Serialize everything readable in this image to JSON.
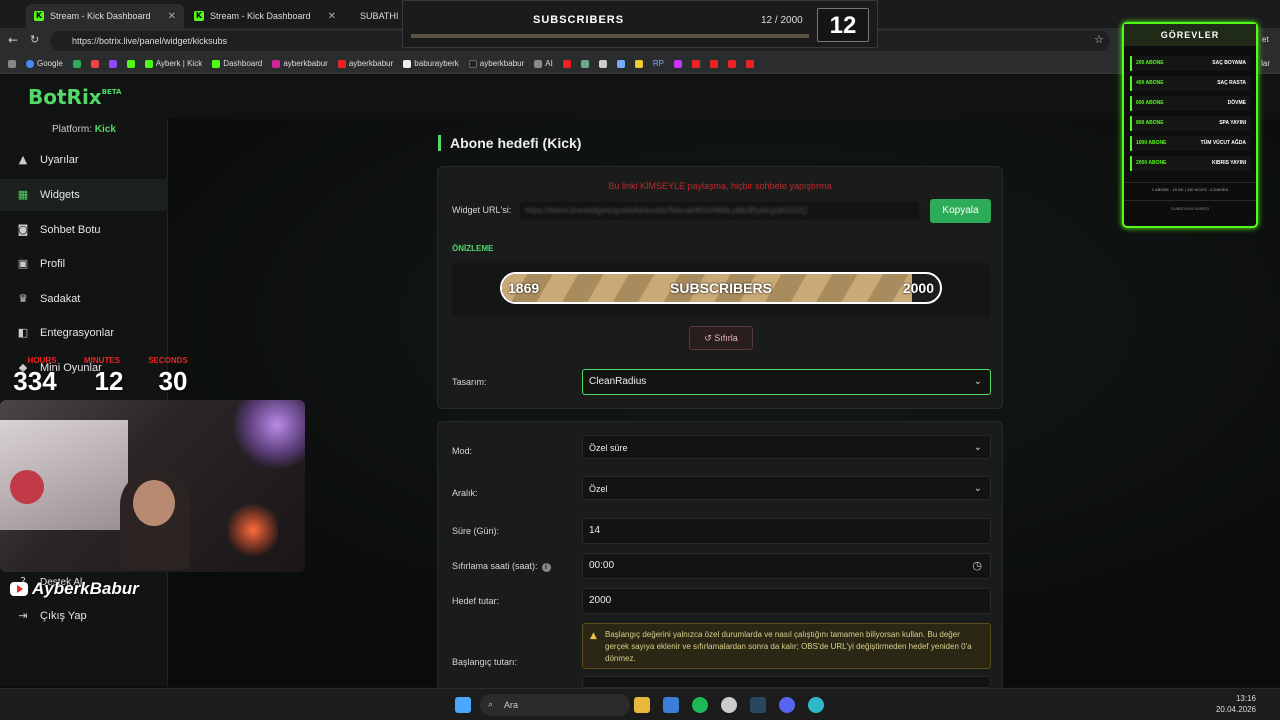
{
  "browser": {
    "tabs": [
      {
        "label": "Stream - Kick Dashboard"
      },
      {
        "label": "Stream - Kick Dashboard"
      },
      {
        "label": "SUBATHI"
      }
    ],
    "url": "https://botrix.live/panel/widget/kicksubs",
    "right_partial": "et",
    "bookmarks": [
      "Google",
      "Ayberk | Kick",
      "Dashboard",
      "ayberkbabur",
      "ayberkbabur",
      "baburayberk",
      "ayberkbabur",
      "AI",
      "RP",
      "lar"
    ]
  },
  "app": {
    "logo": "BotRix",
    "logo_badge": "BETA",
    "platform_label": "Platform:",
    "platform_value": "Kick"
  },
  "sidebar": {
    "items": [
      {
        "label": "Uyarılar",
        "icon": "warning-icon"
      },
      {
        "label": "Widgets",
        "icon": "grid-icon"
      },
      {
        "label": "Sohbet Botu",
        "icon": "robot-icon"
      },
      {
        "label": "Profil",
        "icon": "profile-icon"
      },
      {
        "label": "Sadakat",
        "icon": "trophy-icon"
      },
      {
        "label": "Entegrasyonlar",
        "icon": "integration-icon"
      },
      {
        "label": "Mini Oyunlar",
        "icon": "game-icon"
      },
      {
        "label": "Destek Al",
        "icon": "support-icon"
      },
      {
        "label": "Çıkış Yap",
        "icon": "logout-icon"
      }
    ]
  },
  "main": {
    "title": "Abone hedefi (Kick)",
    "warning": "Bu linki KİMSEYLE paylaşma, hiçbir sohbete yapıştırma",
    "url_label": "Widget URL'si:",
    "url_value": "https://botrix.live/widgets/goals/kicksubs?bid=aHR0cHM6Ly9ib3RyaXgubGl2ZQ",
    "copy_label": "Kopyala",
    "preview_label": "ÖNİZLEME",
    "preview": {
      "start": "1869",
      "title": "SUBSCRIBERS",
      "goal": "2000",
      "progress": 0.935
    },
    "reset_label": "Sıfırla",
    "design_label": "Tasarım:",
    "design_value": "CleanRadius"
  },
  "form": {
    "mod_label": "Mod:",
    "mod_value": "Özel süre",
    "range_label": "Aralık:",
    "range_value": "Özel",
    "duration_label": "Süre (Gün):",
    "duration_value": "14",
    "reset_time_label": "Sıfırlama saati (saat):",
    "reset_time_value": "00:00",
    "target_label": "Hedef tutar:",
    "target_value": "2000",
    "start_label": "Başlangıç tutarı:",
    "note": "Başlangıç değerini yalnızca özel durumlarda ve nasıl çalıştığını tamamen biliyorsan kullan. Bu değer gerçek sayıya eklenir ve sıfırlamalardan sonra da kalır; OBS'de URL'yi değiştirmeden hedef yeniden 0'a dönmez."
  },
  "overlay": {
    "subs_title": "SUBSCRIBERS",
    "subs_count": "12 / 2000",
    "subs_box": "12",
    "gorevler_title": "GÖREVLER",
    "gorevler": [
      {
        "goal": "200 ABONE",
        "task": "SAÇ BOYAMA"
      },
      {
        "goal": "400 ABONE",
        "task": "SAÇ RASTA"
      },
      {
        "goal": "600 ABONE",
        "task": "DÖVME"
      },
      {
        "goal": "800 ABONE",
        "task": "SPA YAYINI"
      },
      {
        "goal": "1000 ABONE",
        "task": "TÜM VÜCUT AĞDA"
      },
      {
        "goal": "2000 ABONE",
        "task": "KIBRIS YAYINI"
      }
    ],
    "gorevler_foot": "1 ABONE - 10 DK | 100 KICKS - 5 DAKİKA",
    "gorevler_foot2": "SUBATHON SÜRESİ",
    "timer": {
      "hours_label": "HOURS",
      "hours": "334",
      "minutes_label": "MINUTES",
      "minutes": "12",
      "seconds_label": "SECONDS",
      "seconds": "30"
    },
    "streamer_name": "AyberkBabur"
  },
  "taskbar": {
    "search": "Ara",
    "time": "13:16",
    "date": "20.04.2026"
  }
}
